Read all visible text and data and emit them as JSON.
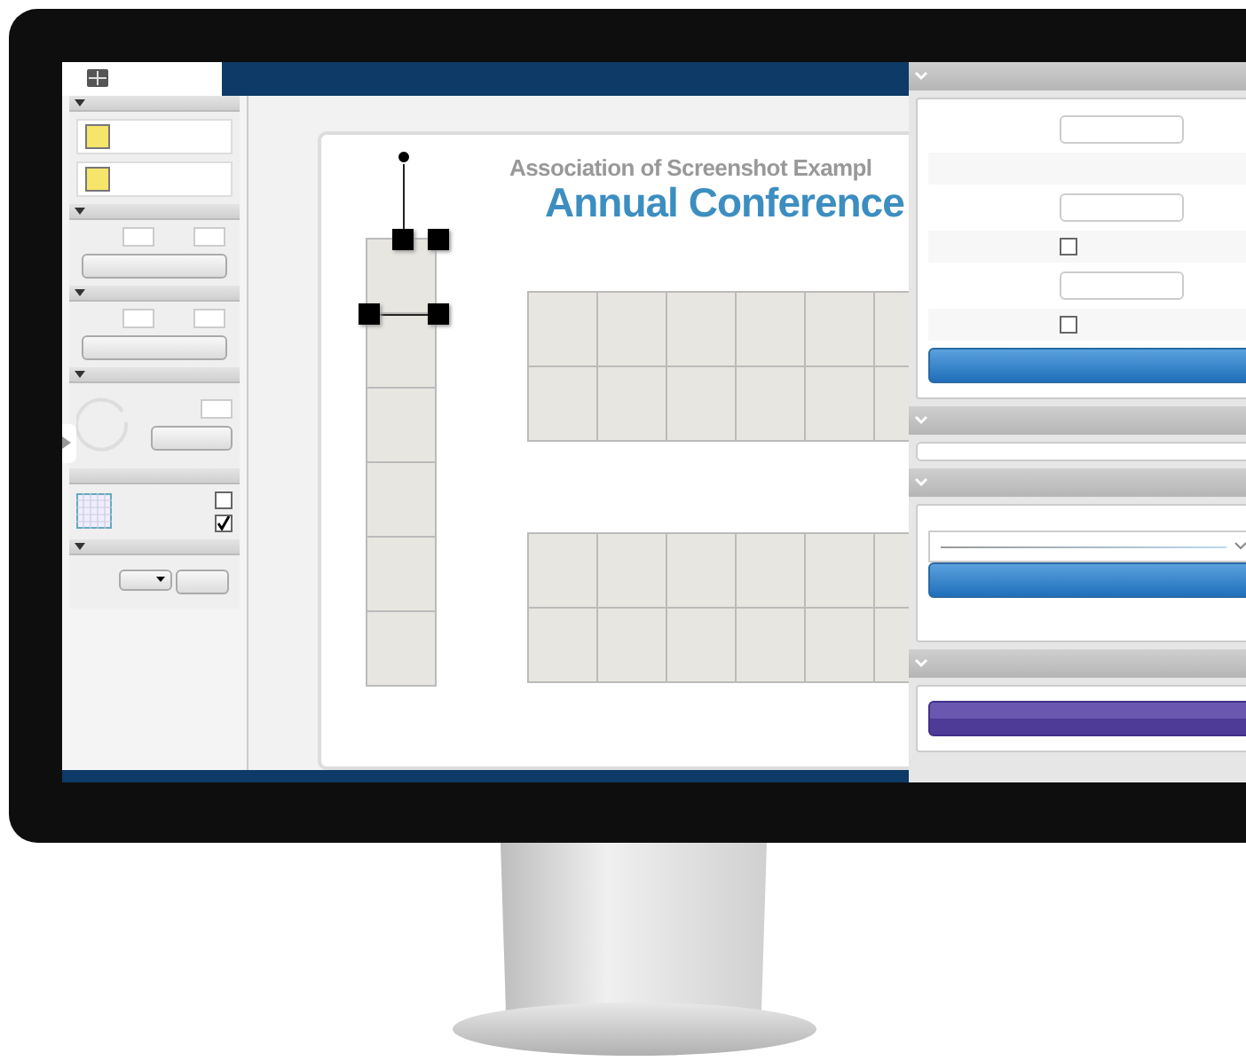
{
  "canvas": {
    "heading": "Association of Screenshot Exampl",
    "title": "Annual Conference"
  },
  "left_panel": {
    "checkboxes": [
      {
        "checked": false
      },
      {
        "checked": true
      }
    ]
  },
  "right_panel": {
    "checkboxes": [
      {
        "checked": false
      },
      {
        "checked": false
      }
    ]
  }
}
